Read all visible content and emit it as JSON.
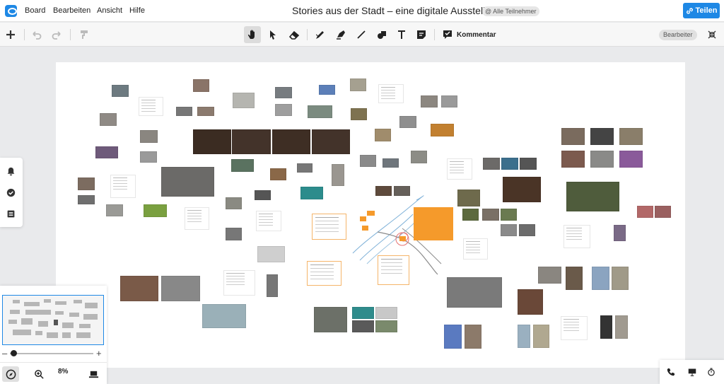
{
  "menu": {
    "items": [
      "Board",
      "Bearbeiten",
      "Ansicht",
      "Hilfe"
    ]
  },
  "header": {
    "title": "Stories aus der Stadt – eine digitale Ausstellung",
    "participants_badge": "@ Alle Teilnehmer",
    "share_label": "Teilen"
  },
  "toolbar": {
    "comment_label": "Kommentar",
    "role_badge": "Bearbeiter",
    "tools": [
      "add-icon",
      "undo-icon",
      "redo-icon",
      "format-painter-icon",
      "hand-icon",
      "pointer-icon",
      "eraser-icon",
      "pen-icon",
      "highlighter-icon",
      "line-icon",
      "shapes-icon",
      "text-icon",
      "sticky-note-icon",
      "comment-icon"
    ]
  },
  "navigator": {
    "zoom_value": "8%",
    "zoom_out_label": "–",
    "zoom_in_label": "+"
  },
  "colors": {
    "accent": "#1e88e5",
    "note_orange": "#f59a2b"
  }
}
